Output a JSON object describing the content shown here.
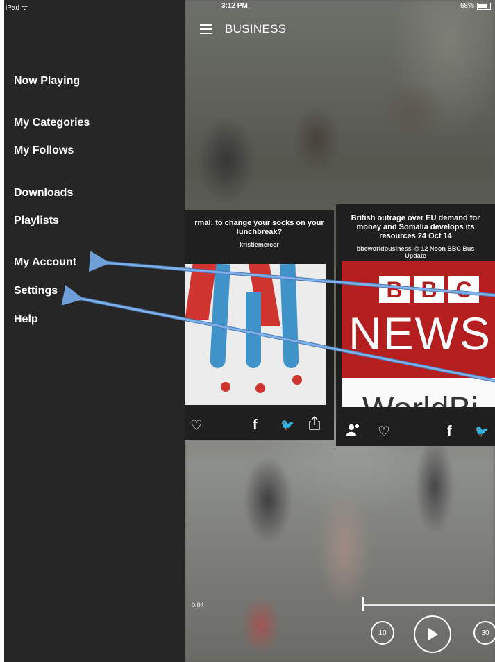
{
  "status_bar": {
    "device": "iPad",
    "time": "3:12 PM",
    "battery": "68%",
    "battery_level": 0.68
  },
  "header": {
    "title": "BUSINESS",
    "menu_icon": "hamburger-icon"
  },
  "sidebar": {
    "items": [
      {
        "label": "Now Playing"
      },
      {
        "label": "My Categories"
      },
      {
        "label": "My Follows"
      },
      {
        "label": "Downloads"
      },
      {
        "label": "Playlists"
      },
      {
        "label": "My Account"
      },
      {
        "label": "Settings"
      },
      {
        "label": "Help"
      }
    ]
  },
  "cards": [
    {
      "title_line1": "rmal: to change your socks on your",
      "title_line2": "lunchbreak?",
      "author": "kristiemercer",
      "image": "superhero-socks-image",
      "actions": [
        "heart-icon",
        "facebook-icon",
        "twitter-icon",
        "share-icon"
      ]
    },
    {
      "title_line1": "British outrage over EU demand for",
      "title_line2": "money and Somalia develops its",
      "title_line3": "resources 24 Oct 14",
      "source_line1": "bbcworldbusiness @ 12 Noon BBC Bus",
      "source_line2": "Update",
      "image_letters": [
        "B",
        "B",
        "C"
      ],
      "image_word": "NEWS",
      "image_subword": "WorldBi",
      "actions": [
        "follow-user-icon",
        "heart-icon",
        "facebook-icon",
        "twitter-icon"
      ]
    }
  ],
  "player": {
    "elapsed": "0:04",
    "rewind_label": "10",
    "forward_label": "30"
  },
  "colors": {
    "sidebar_bg": "#262626",
    "arrow": "#6f9fd8",
    "bbc_red": "#b41e1e"
  }
}
